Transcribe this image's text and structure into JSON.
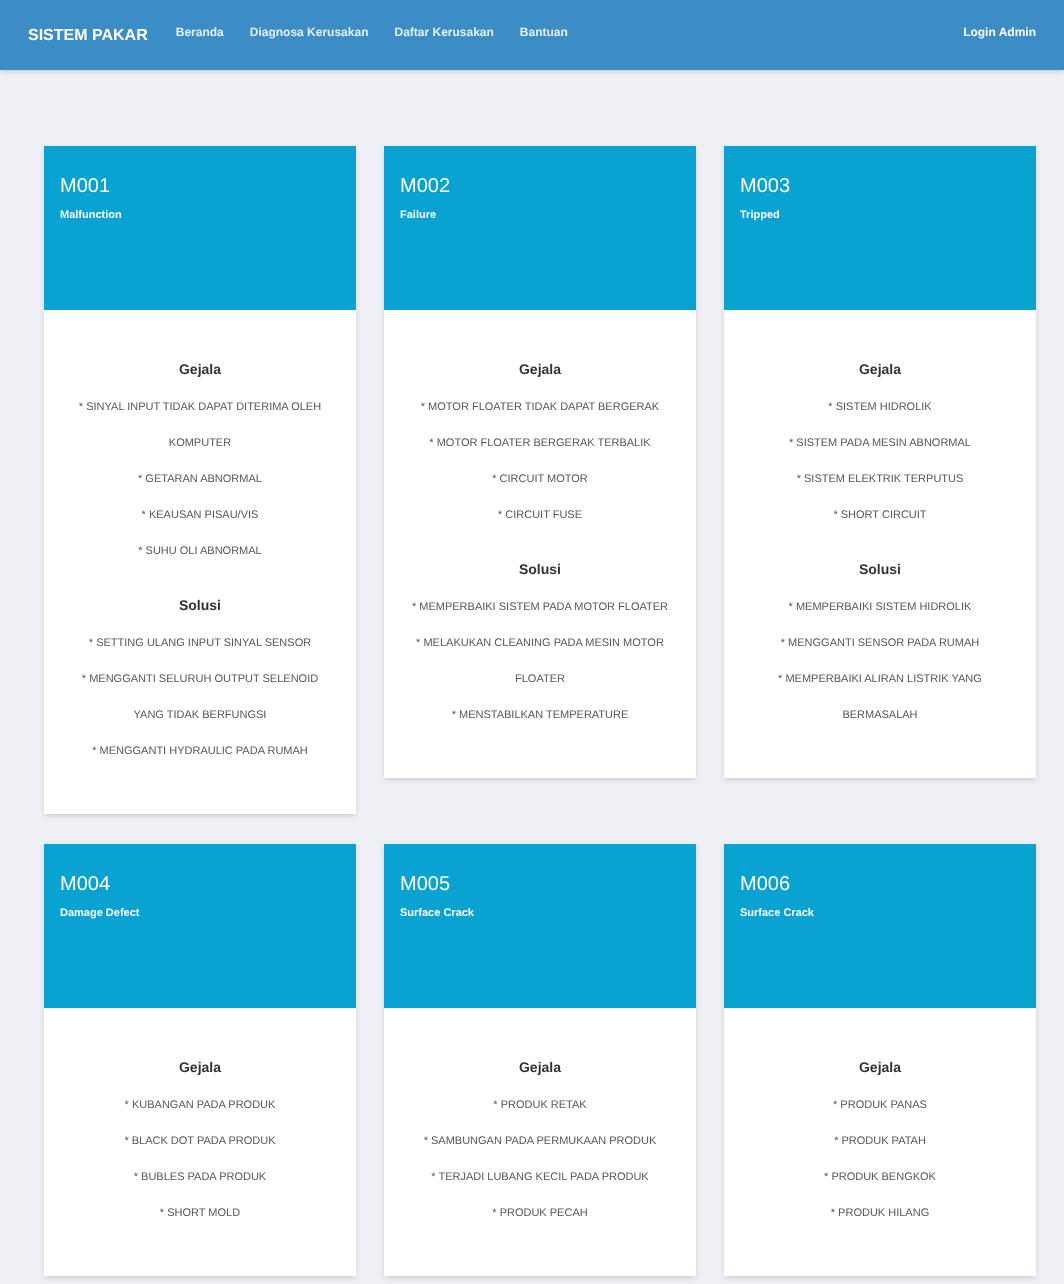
{
  "navbar": {
    "brand": "SISTEM PAKAR",
    "links": [
      {
        "label": "Beranda"
      },
      {
        "label": "Diagnosa Kerusakan"
      },
      {
        "label": "Daftar Kerusakan"
      },
      {
        "label": "Bantuan"
      }
    ],
    "login": "Login Admin"
  },
  "cards": [
    {
      "code": "M001",
      "name": "Malfunction",
      "symptoms_title": "Gejala",
      "symptoms": [
        "* SINYAL INPUT TIDAK DAPAT DITERIMA OLEH KOMPUTER",
        "* GETARAN ABNORMAL",
        "* KEAUSAN PISAU/VIS",
        "* SUHU OLI ABNORMAL"
      ],
      "solutions_title": "Solusi",
      "solutions": [
        "* SETTING ULANG INPUT SINYAL SENSOR",
        "* MENGGANTI SELURUH OUTPUT SELENOID YANG TIDAK BERFUNGSI",
        "* MENGGANTI HYDRAULIC PADA RUMAH"
      ]
    },
    {
      "code": "M002",
      "name": "Failure",
      "symptoms_title": "Gejala",
      "symptoms": [
        "* MOTOR FLOATER TIDAK DAPAT BERGERAK",
        "* MOTOR FLOATER BERGERAK TERBALIK",
        "* CIRCUIT MOTOR",
        "* CIRCUIT FUSE"
      ],
      "solutions_title": "Solusi",
      "solutions": [
        "* MEMPERBAIKI SISTEM PADA MOTOR FLOATER",
        "* MELAKUKAN CLEANING PADA MESIN MOTOR FLOATER",
        "* MENSTABILKAN TEMPERATURE"
      ]
    },
    {
      "code": "M003",
      "name": "Tripped",
      "symptoms_title": "Gejala",
      "symptoms": [
        "* SISTEM HIDROLIK",
        "* SISTEM PADA MESIN ABNORMAL",
        "* SISTEM ELEKTRIK TERPUTUS",
        "* SHORT CIRCUIT"
      ],
      "solutions_title": "Solusi",
      "solutions": [
        "* MEMPERBAIKI SISTEM HIDROLIK",
        "* MENGGANTI SENSOR PADA RUMAH",
        "* MEMPERBAIKI ALIRAN LISTRIK YANG BERMASALAH"
      ]
    },
    {
      "code": "M004",
      "name": "Damage Defect",
      "symptoms_title": "Gejala",
      "symptoms": [
        "* KUBANGAN PADA PRODUK",
        "* BLACK DOT PADA PRODUK",
        "* BUBLES PADA PRODUK",
        "* SHORT MOLD"
      ]
    },
    {
      "code": "M005",
      "name": "Surface Crack",
      "symptoms_title": "Gejala",
      "symptoms": [
        "* PRODUK RETAK",
        "* SAMBUNGAN PADA PERMUKAAN PRODUK",
        "* TERJADI LUBANG KECIL PADA PRODUK",
        "* PRODUK PECAH"
      ]
    },
    {
      "code": "M006",
      "name": "Surface Crack",
      "symptoms_title": "Gejala",
      "symptoms": [
        "* PRODUK PANAS",
        "* PRODUK PATAH",
        "* PRODUK BENGKOK",
        "* PRODUK HILANG"
      ]
    }
  ]
}
